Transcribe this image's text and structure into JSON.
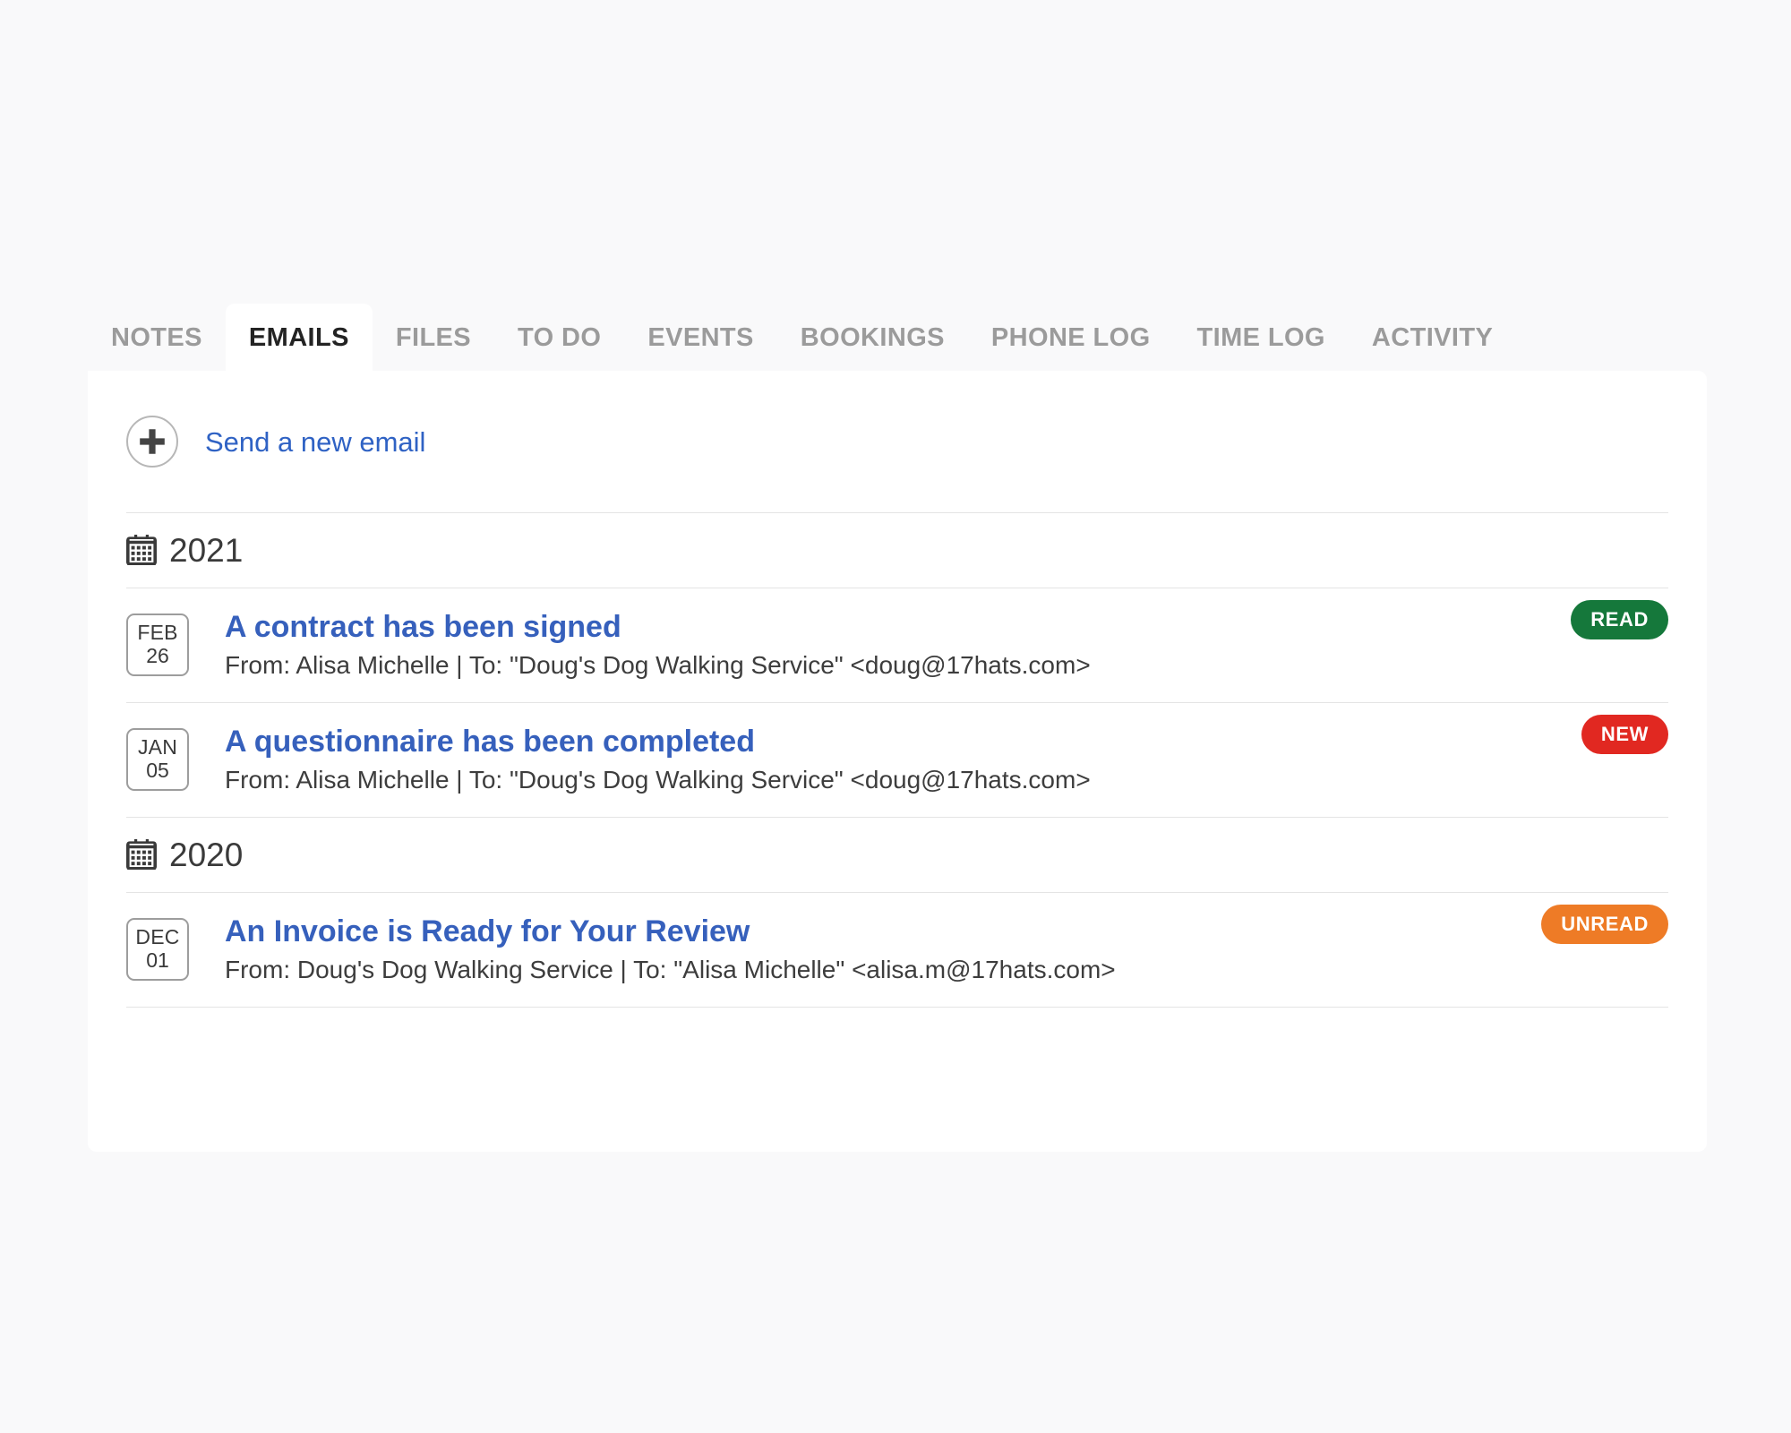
{
  "tabs": [
    {
      "label": "NOTES",
      "active": false
    },
    {
      "label": "EMAILS",
      "active": true
    },
    {
      "label": "FILES",
      "active": false
    },
    {
      "label": "TO DO",
      "active": false
    },
    {
      "label": "EVENTS",
      "active": false
    },
    {
      "label": "BOOKINGS",
      "active": false
    },
    {
      "label": "PHONE LOG",
      "active": false
    },
    {
      "label": "TIME LOG",
      "active": false
    },
    {
      "label": "ACTIVITY",
      "active": false
    }
  ],
  "compose": {
    "icon": "plus-circle-icon",
    "label": "Send a new email"
  },
  "groups": [
    {
      "icon": "calendar-icon",
      "year": "2021",
      "emails": [
        {
          "month": "FEB",
          "day": "26",
          "subject": "A contract has been signed",
          "meta": "From: Alisa Michelle | To: \"Doug's Dog Walking Service\" <doug@17hats.com>",
          "status": "READ",
          "status_color": "#15783b"
        },
        {
          "month": "JAN",
          "day": "05",
          "subject": "A questionnaire has been completed",
          "meta": "From: Alisa Michelle | To: \"Doug's Dog Walking Service\" <doug@17hats.com>",
          "status": "NEW",
          "status_color": "#e12821"
        }
      ]
    },
    {
      "icon": "calendar-icon",
      "year": "2020",
      "emails": [
        {
          "month": "DEC",
          "day": "01",
          "subject": "An Invoice is Ready for Your Review",
          "meta": "From: Doug's Dog Walking Service | To: \"Alisa Michelle\" <alisa.m@17hats.com>",
          "status": "UNREAD",
          "status_color": "#ee7b26"
        }
      ]
    }
  ],
  "colors": {
    "page_background": "#f9f9fa",
    "card_background": "#ffffff",
    "link_blue": "#2f62c4",
    "subject_blue": "#3660bc",
    "tab_inactive": "#9b9b9b",
    "tab_active": "#232323",
    "divider": "#e4e4e4"
  }
}
